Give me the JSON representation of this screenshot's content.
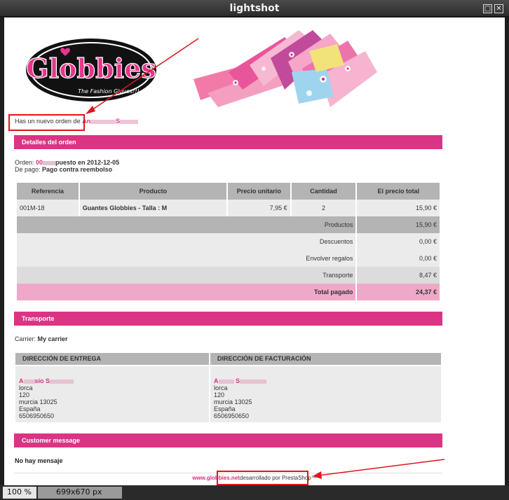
{
  "window": {
    "title": "lightshot",
    "zoom": "100 %",
    "dimensions": "699x670 px"
  },
  "email": {
    "logo_text": "Globbies",
    "logo_tagline": "The Fashion Gloves!!!",
    "greeting_prefix": "Has un nuevo orden de",
    "customer_short": "An",
    "customer_tail": "S",
    "order_section": "Detalles del orden",
    "order_label": "Orden:",
    "order_ref": "00",
    "order_placed": "puesto en 2012-12-05",
    "payment_label": "De pago:",
    "payment_value": "Pago contra reembolso",
    "table": {
      "headers": [
        "Referencia",
        "Producto",
        "Precio unitario",
        "Cantidad",
        "El precio total"
      ],
      "product": {
        "ref": "001M-18",
        "name": "Guantes Globbies - Talla : M",
        "unit_price": "7,95 €",
        "qty": "2",
        "total": "15,90 €"
      },
      "summary": [
        {
          "label": "Productos",
          "value": "15,90 €"
        },
        {
          "label": "Descuentos",
          "value": "0,00 €"
        },
        {
          "label": "Envolver regalos",
          "value": "0,00 €"
        },
        {
          "label": "Transporte",
          "value": "8,47 €"
        }
      ],
      "total_label": "Total pagado",
      "total_value": "24,37 €"
    },
    "transport_section": "Transporte",
    "carrier_label": "Carrier:",
    "carrier_value": "My carrier",
    "delivery": {
      "heading": "DIRECCIÓN DE ENTREGA",
      "name": "A",
      "name_mid": "sio",
      "name_tail": "S",
      "lines": [
        "lorca",
        "120",
        "murcia 13025",
        "España",
        "6506950650"
      ]
    },
    "billing": {
      "heading": "DIRECCIÓN DE FACTURACIÓN",
      "name": "A",
      "name_tail": "S",
      "lines": [
        "lorca",
        "120",
        "murcia 13025",
        "España",
        "6506950650"
      ]
    },
    "message_section": "Customer message",
    "message_value": "No hay mensaje",
    "footer_site": "www.globbies.net",
    "footer_text": "desarrollado por PrestaShop™"
  },
  "colors": {
    "brand_pink": "#db3484",
    "link_pink": "#d5337f",
    "total_row": "#f0a8c8",
    "annotation_red": "#e0141e"
  }
}
